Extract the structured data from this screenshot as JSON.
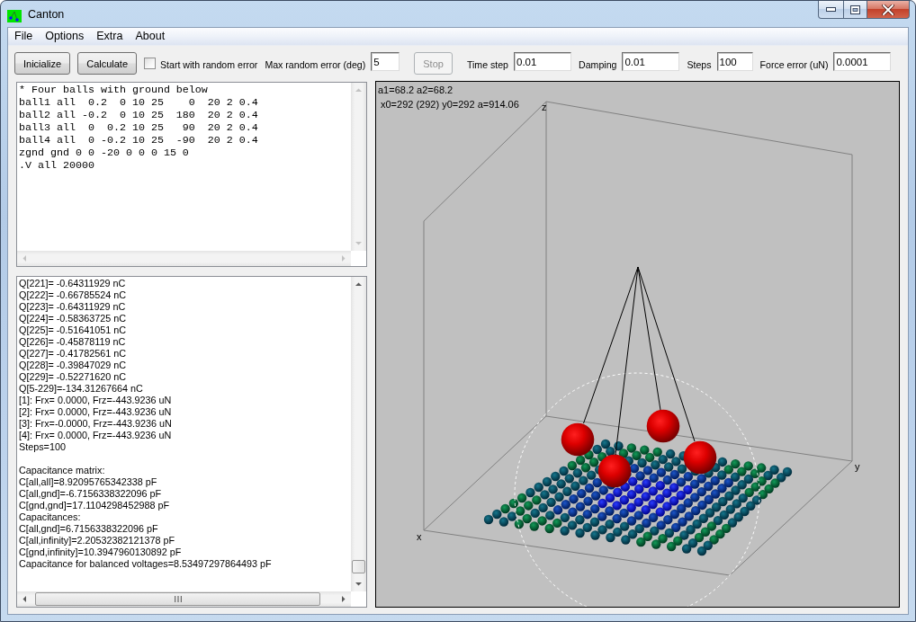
{
  "window": {
    "title": "Canton"
  },
  "menu": [
    "File",
    "Options",
    "Extra",
    "About"
  ],
  "toolbar": {
    "items": [
      {
        "kind": "button",
        "label": "Inicialize",
        "disabled": false
      },
      {
        "kind": "button",
        "label": "Calculate",
        "disabled": false
      },
      {
        "kind": "checkbox",
        "label": "Start with random error",
        "checked": false
      },
      {
        "kind": "field",
        "label": "Max random error (deg)",
        "value": "5"
      },
      {
        "kind": "button",
        "label": "Stop",
        "disabled": true
      },
      {
        "kind": "field",
        "label": "Time step",
        "value": "0.01"
      },
      {
        "kind": "field",
        "label": "Damping",
        "value": "0.01"
      },
      {
        "kind": "field",
        "label": "Steps",
        "value": "100"
      },
      {
        "kind": "field",
        "label": "Force error (uN)",
        "value": "0.0001"
      }
    ]
  },
  "editor": {
    "lines": [
      "* Four balls with ground below",
      "ball1 all  0.2  0 10 25    0  20 2 0.4",
      "ball2 all -0.2  0 10 25  180  20 2 0.4",
      "ball3 all  0  0.2 10 25   90  20 2 0.4",
      "ball4 all  0 -0.2 10 25  -90  20 2 0.4",
      "zgnd gnd 0 0 -20 0 0 0 15 0",
      ".V all 20000"
    ]
  },
  "output": {
    "blocks": [
      [
        "Q[221]= -0.64311929 nC",
        "Q[222]= -0.66785524 nC",
        "Q[223]= -0.64311929 nC",
        "Q[224]= -0.58363725 nC",
        "Q[225]= -0.51641051 nC",
        "Q[226]= -0.45878119 nC",
        "Q[227]= -0.41782561 nC",
        "Q[228]= -0.39847029 nC",
        "Q[229]= -0.52271620 nC",
        "Q[5-229]=-134.31267664 nC",
        "[1]: Frx= 0.0000, Frz=-443.9236 uN",
        "[2]: Frx= 0.0000, Frz=-443.9236 uN",
        "[3]: Frx=-0.0000, Frz=-443.9236 uN",
        "[4]: Frx= 0.0000, Frz=-443.9236 uN",
        "Steps=100"
      ],
      [
        "Capacitance matrix:",
        "C[all,all]=8.92095765342338 pF",
        "C[all,gnd]=-6.7156338322096 pF",
        "C[gnd,gnd]=17.1104298452988 pF",
        "Capacitances:",
        "C[all,gnd]=6.7156338322096 pF",
        "C[all,infinity]=2.20532382121378 pF",
        "C[gnd,infinity]=10.3947960130892 pF",
        "Capacitance for balanced voltages=8.53497297864493 pF"
      ]
    ]
  },
  "canvas": {
    "readouts": [
      "a1=68.2 a2=68.2",
      "x0=292 (292) y0=292 a=914.06"
    ],
    "axis_labels": {
      "z": "z",
      "y": "y",
      "x": "x"
    }
  }
}
